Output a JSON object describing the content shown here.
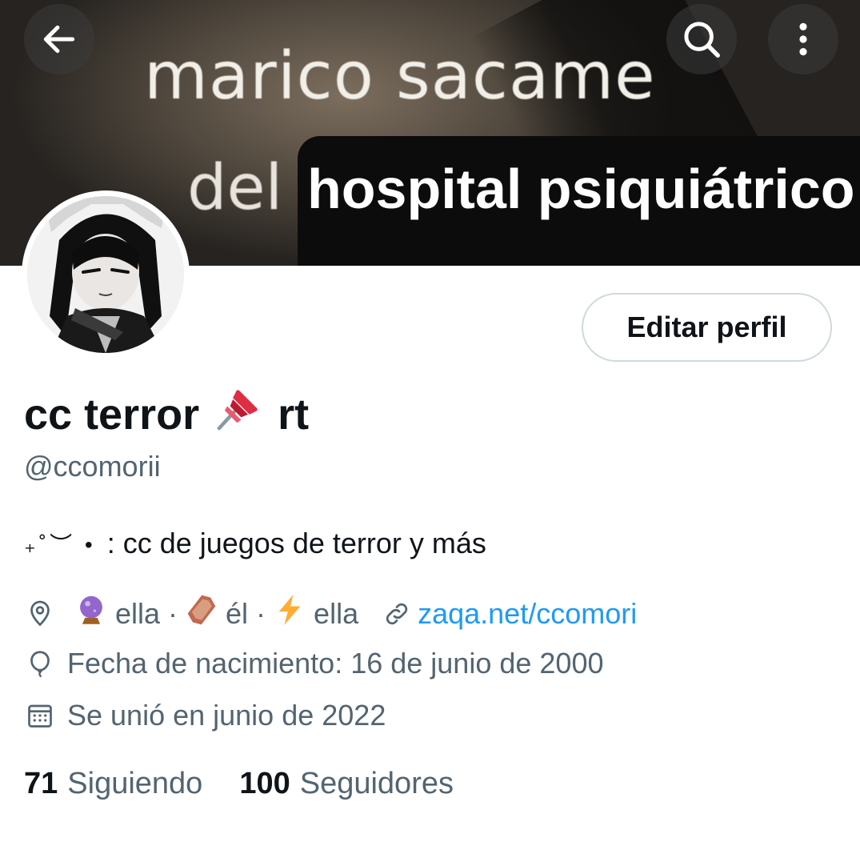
{
  "header": {
    "banner_text_line1": "marico sacame",
    "banner_text_line2a": "del",
    "banner_text_line2b": "hospital psiquiátrico",
    "back_icon": "arrow-left-icon",
    "search_icon": "search-icon",
    "more_icon": "more-vertical-icon"
  },
  "profile": {
    "edit_label": "Editar perfil",
    "name_part1": "cc terror",
    "name_emoji": "pushpin",
    "name_part2": "rt",
    "handle": "@ccomorii",
    "bio_decoration": "₊˚︶ •",
    "bio_text": ":  cc de juegos de terror y más"
  },
  "details": {
    "location_segments": [
      "ella ·",
      "él ·",
      "ella"
    ],
    "location_emojis": [
      "crystal-ball",
      "coffin",
      "high-voltage"
    ],
    "website": "zaqa.net/ccomori",
    "birthday": "Fecha de nacimiento: 16 de junio de 2000",
    "joined": "Se unió en junio de 2022"
  },
  "stats": {
    "following_count": "71",
    "following_label": "Siguiendo",
    "followers_count": "100",
    "followers_label": "Seguidores"
  },
  "colors": {
    "primary_text": "#0f1419",
    "secondary_text": "#536471",
    "link": "#1d9bf0",
    "button_border": "#cfd9de"
  }
}
